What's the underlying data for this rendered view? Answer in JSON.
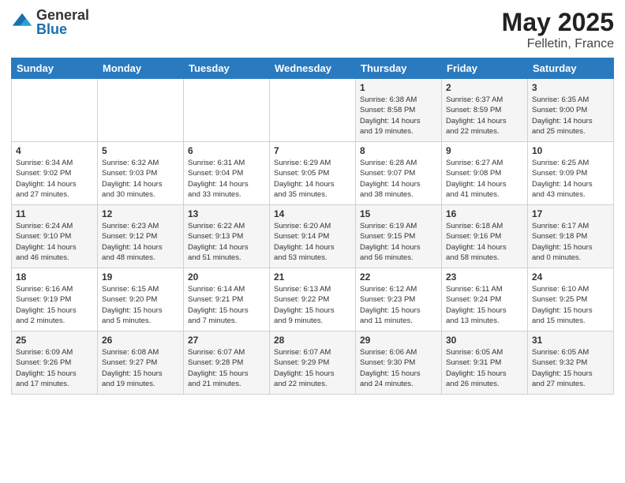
{
  "logo": {
    "general": "General",
    "blue": "Blue"
  },
  "title": {
    "month_year": "May 2025",
    "location": "Felletin, France"
  },
  "weekdays": [
    "Sunday",
    "Monday",
    "Tuesday",
    "Wednesday",
    "Thursday",
    "Friday",
    "Saturday"
  ],
  "weeks": [
    [
      {
        "day": "",
        "info": ""
      },
      {
        "day": "",
        "info": ""
      },
      {
        "day": "",
        "info": ""
      },
      {
        "day": "",
        "info": ""
      },
      {
        "day": "1",
        "info": "Sunrise: 6:38 AM\nSunset: 8:58 PM\nDaylight: 14 hours\nand 19 minutes."
      },
      {
        "day": "2",
        "info": "Sunrise: 6:37 AM\nSunset: 8:59 PM\nDaylight: 14 hours\nand 22 minutes."
      },
      {
        "day": "3",
        "info": "Sunrise: 6:35 AM\nSunset: 9:00 PM\nDaylight: 14 hours\nand 25 minutes."
      }
    ],
    [
      {
        "day": "4",
        "info": "Sunrise: 6:34 AM\nSunset: 9:02 PM\nDaylight: 14 hours\nand 27 minutes."
      },
      {
        "day": "5",
        "info": "Sunrise: 6:32 AM\nSunset: 9:03 PM\nDaylight: 14 hours\nand 30 minutes."
      },
      {
        "day": "6",
        "info": "Sunrise: 6:31 AM\nSunset: 9:04 PM\nDaylight: 14 hours\nand 33 minutes."
      },
      {
        "day": "7",
        "info": "Sunrise: 6:29 AM\nSunset: 9:05 PM\nDaylight: 14 hours\nand 35 minutes."
      },
      {
        "day": "8",
        "info": "Sunrise: 6:28 AM\nSunset: 9:07 PM\nDaylight: 14 hours\nand 38 minutes."
      },
      {
        "day": "9",
        "info": "Sunrise: 6:27 AM\nSunset: 9:08 PM\nDaylight: 14 hours\nand 41 minutes."
      },
      {
        "day": "10",
        "info": "Sunrise: 6:25 AM\nSunset: 9:09 PM\nDaylight: 14 hours\nand 43 minutes."
      }
    ],
    [
      {
        "day": "11",
        "info": "Sunrise: 6:24 AM\nSunset: 9:10 PM\nDaylight: 14 hours\nand 46 minutes."
      },
      {
        "day": "12",
        "info": "Sunrise: 6:23 AM\nSunset: 9:12 PM\nDaylight: 14 hours\nand 48 minutes."
      },
      {
        "day": "13",
        "info": "Sunrise: 6:22 AM\nSunset: 9:13 PM\nDaylight: 14 hours\nand 51 minutes."
      },
      {
        "day": "14",
        "info": "Sunrise: 6:20 AM\nSunset: 9:14 PM\nDaylight: 14 hours\nand 53 minutes."
      },
      {
        "day": "15",
        "info": "Sunrise: 6:19 AM\nSunset: 9:15 PM\nDaylight: 14 hours\nand 56 minutes."
      },
      {
        "day": "16",
        "info": "Sunrise: 6:18 AM\nSunset: 9:16 PM\nDaylight: 14 hours\nand 58 minutes."
      },
      {
        "day": "17",
        "info": "Sunrise: 6:17 AM\nSunset: 9:18 PM\nDaylight: 15 hours\nand 0 minutes."
      }
    ],
    [
      {
        "day": "18",
        "info": "Sunrise: 6:16 AM\nSunset: 9:19 PM\nDaylight: 15 hours\nand 2 minutes."
      },
      {
        "day": "19",
        "info": "Sunrise: 6:15 AM\nSunset: 9:20 PM\nDaylight: 15 hours\nand 5 minutes."
      },
      {
        "day": "20",
        "info": "Sunrise: 6:14 AM\nSunset: 9:21 PM\nDaylight: 15 hours\nand 7 minutes."
      },
      {
        "day": "21",
        "info": "Sunrise: 6:13 AM\nSunset: 9:22 PM\nDaylight: 15 hours\nand 9 minutes."
      },
      {
        "day": "22",
        "info": "Sunrise: 6:12 AM\nSunset: 9:23 PM\nDaylight: 15 hours\nand 11 minutes."
      },
      {
        "day": "23",
        "info": "Sunrise: 6:11 AM\nSunset: 9:24 PM\nDaylight: 15 hours\nand 13 minutes."
      },
      {
        "day": "24",
        "info": "Sunrise: 6:10 AM\nSunset: 9:25 PM\nDaylight: 15 hours\nand 15 minutes."
      }
    ],
    [
      {
        "day": "25",
        "info": "Sunrise: 6:09 AM\nSunset: 9:26 PM\nDaylight: 15 hours\nand 17 minutes."
      },
      {
        "day": "26",
        "info": "Sunrise: 6:08 AM\nSunset: 9:27 PM\nDaylight: 15 hours\nand 19 minutes."
      },
      {
        "day": "27",
        "info": "Sunrise: 6:07 AM\nSunset: 9:28 PM\nDaylight: 15 hours\nand 21 minutes."
      },
      {
        "day": "28",
        "info": "Sunrise: 6:07 AM\nSunset: 9:29 PM\nDaylight: 15 hours\nand 22 minutes."
      },
      {
        "day": "29",
        "info": "Sunrise: 6:06 AM\nSunset: 9:30 PM\nDaylight: 15 hours\nand 24 minutes."
      },
      {
        "day": "30",
        "info": "Sunrise: 6:05 AM\nSunset: 9:31 PM\nDaylight: 15 hours\nand 26 minutes."
      },
      {
        "day": "31",
        "info": "Sunrise: 6:05 AM\nSunset: 9:32 PM\nDaylight: 15 hours\nand 27 minutes."
      }
    ]
  ]
}
